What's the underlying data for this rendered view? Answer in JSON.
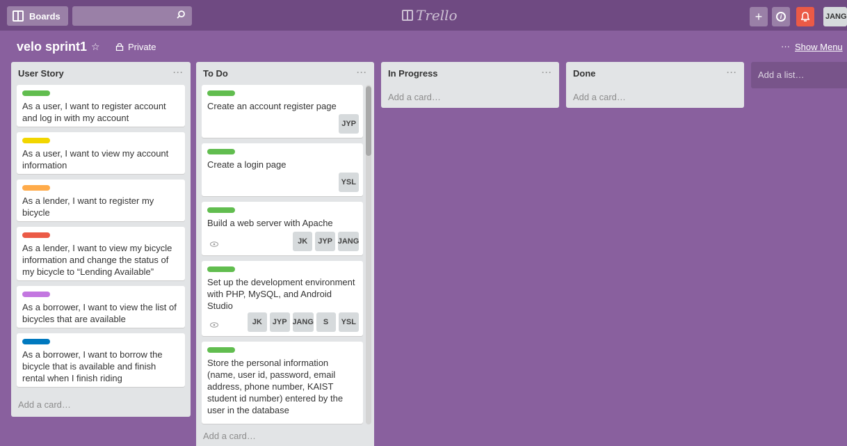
{
  "header": {
    "boards_label": "Boards",
    "logo_text": "Trello",
    "user_initials": "JANG"
  },
  "board": {
    "title": "velo sprint1",
    "privacy": "Private",
    "show_menu": "Show Menu"
  },
  "lists": [
    {
      "title": "User Story",
      "add_card": "Add a card…",
      "cards": [
        {
          "label_color": "#61bd4f",
          "text": "As a user, I want to register account and log in with my account"
        },
        {
          "label_color": "#f2d600",
          "text": "As a user, I want to view my account information"
        },
        {
          "label_color": "#ffab4a",
          "text": "As a lender, I want to register my bicycle"
        },
        {
          "label_color": "#eb5a46",
          "text": "As a lender, I want to view my bicycle information and change the status of my bicycle to “Lending Available”"
        },
        {
          "label_color": "#c377e0",
          "text": "As a borrower, I want to view the list of bicycles that are available"
        },
        {
          "label_color": "#0079bf",
          "text": "As a borrower, I want to borrow the bicycle that is available and finish rental when I finish riding"
        }
      ]
    },
    {
      "title": "To Do",
      "add_card": "Add a card…",
      "cards": [
        {
          "label_color": "#61bd4f",
          "text": "Create an account register page",
          "members": [
            "JYP"
          ]
        },
        {
          "label_color": "#61bd4f",
          "text": "Create a login page",
          "members": [
            "YSL"
          ]
        },
        {
          "label_color": "#61bd4f",
          "text": "Build a web server with Apache",
          "members": [
            "JK",
            "JYP",
            "JANG"
          ]
        },
        {
          "label_color": "#61bd4f",
          "text": "Set up the development environment with PHP, MySQL, and Android Studio",
          "members": [
            "JK",
            "JYP",
            "JANG",
            "S",
            "YSL"
          ]
        },
        {
          "label_color": "#61bd4f",
          "text": "Store the personal information (name, user id, password, email address, phone number, KAIST student id number) entered by the user in the database",
          "members": []
        }
      ]
    },
    {
      "title": "In Progress",
      "add_card": "Add a card…",
      "cards": []
    },
    {
      "title": "Done",
      "add_card": "Add a card…",
      "cards": []
    }
  ],
  "add_list": "Add a list…"
}
